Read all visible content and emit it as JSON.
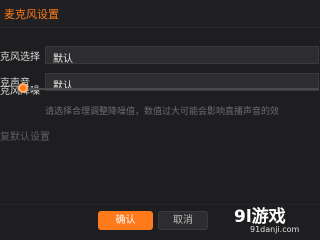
{
  "window": {
    "title": "麦克风设置"
  },
  "form": {
    "mic_select": {
      "label": "克风选择",
      "value": "默认"
    },
    "speaker": {
      "label": "克声音",
      "value": "默认"
    },
    "noise_reduction": {
      "label": "克风降噪",
      "level_percent": 0
    },
    "hint": "请选择合理调整降噪值，数值过大可能会影响直播声音的效",
    "restore_default": "复默认设置"
  },
  "footer": {
    "confirm_label": "确认",
    "cancel_label": "取消"
  },
  "watermark": {
    "main": "9l游戏",
    "sub": "91danji.com"
  },
  "colors": {
    "accent": "#ff7a1a",
    "background": "#1e1e20"
  }
}
